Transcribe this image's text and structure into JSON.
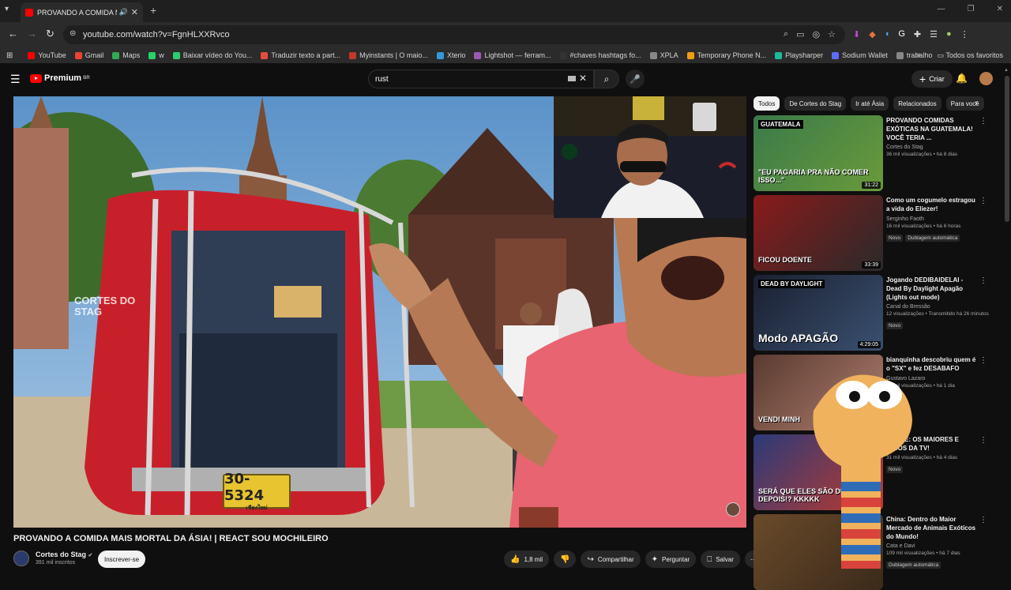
{
  "browser": {
    "tab_title": "PROVANDO A COMIDA MA",
    "url": "youtube.com/watch?v=FgnHLXXRvco",
    "bookmarks": [
      {
        "label": "YouTube",
        "color": "#ff0000"
      },
      {
        "label": "Gmail",
        "color": "#ea4335"
      },
      {
        "label": "Maps",
        "color": "#34a853"
      },
      {
        "label": "w",
        "color": "#25d366"
      },
      {
        "label": "Baixar vídeo do You...",
        "color": "#2ecc71"
      },
      {
        "label": "Traduzir texto a part...",
        "color": "#e74c3c"
      },
      {
        "label": "Myinstants | O maio...",
        "color": "#c0392b"
      },
      {
        "label": "Xterio",
        "color": "#3498db"
      },
      {
        "label": "Lightshot — ferram...",
        "color": "#9b59b6"
      },
      {
        "label": "#chaves hashtags fo...",
        "color": "#333333"
      },
      {
        "label": "XPLA",
        "color": "#888888"
      },
      {
        "label": "Temporary Phone N...",
        "color": "#f39c12"
      },
      {
        "label": "Playsharper",
        "color": "#1abc9c"
      },
      {
        "label": "Sodium Wallet",
        "color": "#5b6cff"
      },
      {
        "label": "trabalho",
        "color": "#888888"
      }
    ],
    "all_bookmarks": "Todos os favoritos"
  },
  "youtube": {
    "logo": "Premium",
    "logo_sup": "BR",
    "search_value": "rust",
    "create_label": "Criar"
  },
  "video": {
    "watermark_line1": "CORTES DO",
    "watermark_line2": "STAG",
    "plate_number": "30-5324",
    "plate_sub": "เชียงใหม่",
    "title": "PROVANDO A COMIDA MAIS MORTAL DA ÁSIA! | REACT SOU MOCHILEIRO",
    "channel": "Cortes do Stag",
    "subscribers": "391 mil inscritos",
    "subscribe_label": "Inscrever-se",
    "likes": "1,8 mil",
    "share_label": "Compartilhar",
    "ask_label": "Perguntar",
    "save_label": "Salvar"
  },
  "chips": [
    "Todos",
    "De Cortes do Stag",
    "Ir até Ásia",
    "Relacionados",
    "Para você"
  ],
  "recommendations": [
    {
      "title": "PROVANDO COMIDAS EXÓTICAS NA GUATEMALA! VOCÊ TERIA ...",
      "channel": "Cortes do Stag",
      "views": "36 mil visualizações • há 8 dias",
      "badges": [],
      "duration": "31:22",
      "thumb_text": "\"EU PAGARIA PRA NÃO COMER ISSO...\"",
      "thumb_label": "GUATEMALA"
    },
    {
      "title": "Como um cogumelo estragou a vida do Eliezer!",
      "channel": "Serginho Faoth",
      "views": "16 mil visualizações • há 6 horas",
      "badges": [
        "Novo",
        "Dublagem automática"
      ],
      "duration": "33:39",
      "thumb_text": "FICOU DOENTE"
    },
    {
      "title": "Jogando DEDIBAIDELAI - Dead By Daylight Apagão (Lights out mode)",
      "channel": "Canal do Bressão",
      "views": "12 visualizações • Transmitido há 26 minutos",
      "badges": [
        "Novo"
      ],
      "duration": "4:29:05",
      "thumb_text": "Modo APAGÃO",
      "thumb_label": "DEAD BY DAYLIGHT"
    },
    {
      "title": "bianquinha descobriu quem é o \"SX\" e fez DESABAFO",
      "channel": "Gustavo Lazaro",
      "views": "16 mil visualizações • há 1 dia",
      "badges": [],
      "duration": "",
      "thumb_text": "VENDI MINH"
    },
    {
      "title": "REAGE: OS MAIORES E ...ICOS DA TV!",
      "channel": "",
      "views": "31 mil visualizações • há 4 dias",
      "badges": [
        "Novo"
      ],
      "duration": "18:57",
      "thumb_text": "SERÁ QUE ELES SÃO DEMITIDOS DEPOIS!? KKKKK"
    },
    {
      "title": "China: Dentro do Maior Mercado de Animais Exóticos do Mundo!",
      "channel": "Cata e Davi",
      "views": "109 mil visualizações • há 7 dias",
      "badges": [
        "Dublagem automática"
      ],
      "duration": "",
      "thumb_text": ""
    }
  ],
  "colors": {
    "accent": "#ff0000",
    "bg": "#0f0f0f"
  }
}
